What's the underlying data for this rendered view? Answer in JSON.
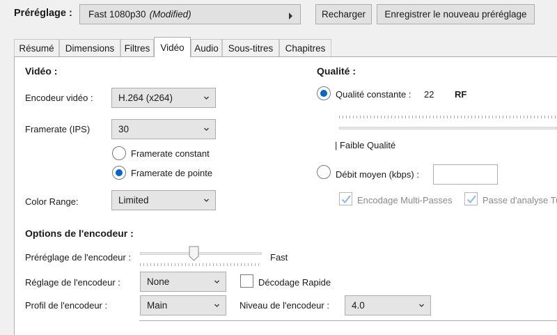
{
  "header": {
    "preset_label": "Préréglage :",
    "preset_name": "Fast 1080p30",
    "preset_state": "(Modified)",
    "reload_button": "Recharger",
    "save_new_button": "Enregistrer le nouveau préréglage"
  },
  "tabs": [
    {
      "label": "Résumé"
    },
    {
      "label": "Dimensions"
    },
    {
      "label": "Filtres"
    },
    {
      "label": "Vidéo",
      "active": true
    },
    {
      "label": "Audio"
    },
    {
      "label": "Sous-titres"
    },
    {
      "label": "Chapitres"
    }
  ],
  "video": {
    "section_title": "Vidéo :",
    "encoder_label": "Encodeur vidéo :",
    "encoder_value": "H.264 (x264)",
    "framerate_label": "Framerate (IPS)",
    "framerate_value": "30",
    "framerate_constant": "Framerate constant",
    "framerate_peak": "Framerate de pointe",
    "framerate_mode": "peak",
    "color_range_label": "Color Range:",
    "color_range_value": "Limited"
  },
  "quality": {
    "section_title": "Qualité :",
    "constant_quality_label": "Qualité constante :",
    "rf_value": "22",
    "rf_unit": "RF",
    "low_quality_label": "| Faible Qualité",
    "avg_bitrate_label": "Débit moyen (kbps) :",
    "avg_bitrate_value": "",
    "multipass_label": "Encodage Multi-Passes",
    "multipass_checked": true,
    "turbo_label": "Passe d'analyse Tu",
    "turbo_checked": true,
    "mode": "constant"
  },
  "encoder_options": {
    "section_title": "Options de l'encodeur :",
    "preset_label": "Préréglage de l'encodeur :",
    "preset_value": "Fast",
    "preset_slider_fraction": 0.43,
    "tune_label": "Réglage de l'encodeur :",
    "tune_value": "None",
    "fast_decode_label": "Décodage Rapide",
    "fast_decode_checked": false,
    "profile_label": "Profil de l'encodeur :",
    "profile_value": "Main",
    "level_label": "Niveau de l'encodeur :",
    "level_value": "4.0"
  },
  "colors": {
    "accent": "#0066cc",
    "button_bg": "#e1e1e1",
    "panel_bg": "#ffffff",
    "window_bg": "#f0f0f0",
    "checkmark": "#3d8fd8"
  }
}
